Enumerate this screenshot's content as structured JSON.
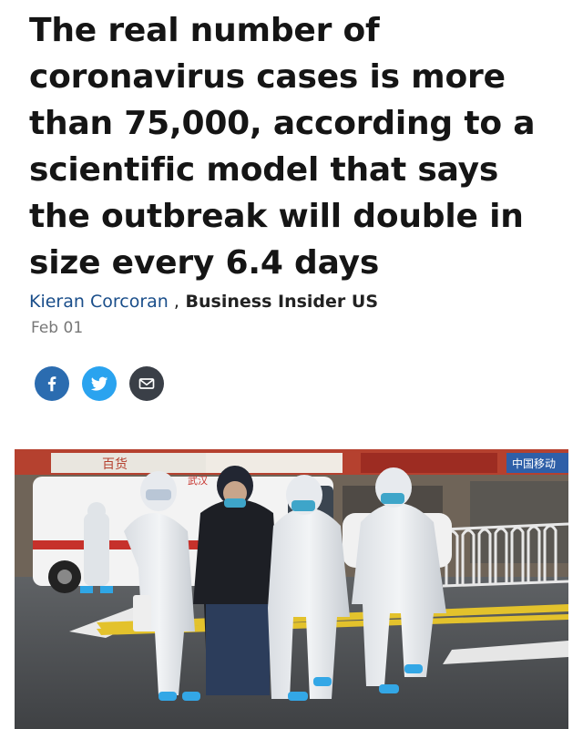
{
  "article": {
    "headline": "The real number of coronavirus cases is more than 75,000, according to a scientific model that says the outbreak will double in size every 6.4 days",
    "author": "Kieran Corcoran",
    "separator": " ,",
    "publisher": " Business Insider US",
    "date": "Feb 01"
  },
  "share": {
    "facebook_icon": "facebook-icon",
    "twitter_icon": "twitter-icon",
    "email_icon": "email-icon",
    "colors": {
      "facebook": "#2b6cb0",
      "twitter": "#2aa3ef",
      "email": "#3a3f47"
    }
  },
  "photo": {
    "storefront_signs": [
      "百货",
      "中国移动"
    ],
    "ambulance_text": "武汉"
  }
}
